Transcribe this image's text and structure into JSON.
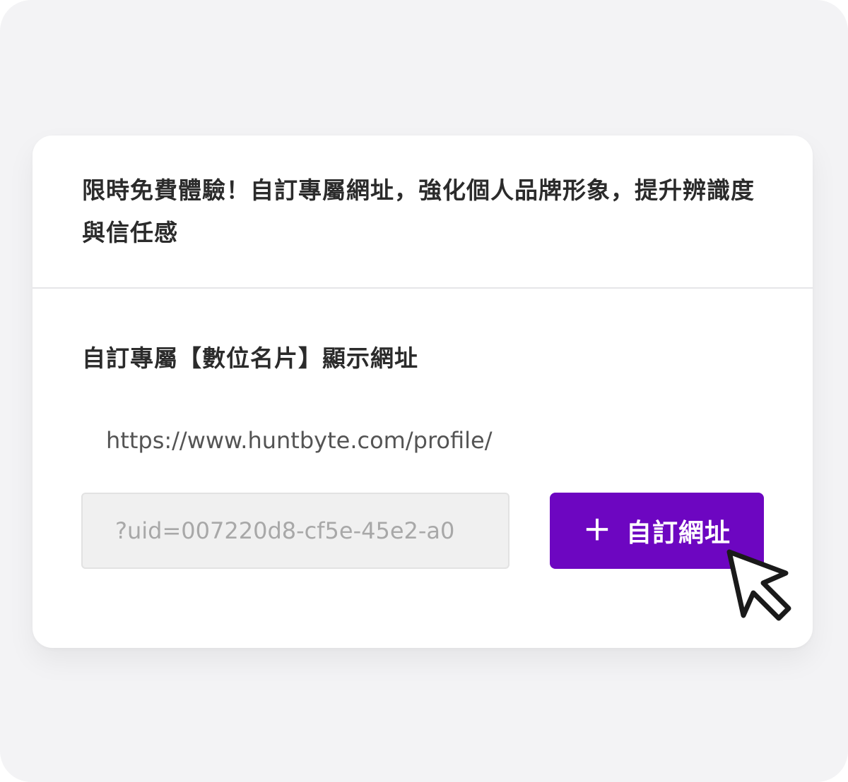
{
  "promo": {
    "text": "限時免費體驗！自訂專屬網址，強化個人品牌形象，提升辨識度與信任感"
  },
  "custom_url": {
    "title": "自訂專屬【數位名片】顯示網址",
    "base_url": "https://www.huntbyte.com/profile/",
    "uid_value": "?uid=007220d8-cf5e-45e2-a0",
    "button_label": "自訂網址",
    "button_icon": "plus-icon"
  },
  "colors": {
    "accent": "#6d06c1",
    "frame_bg": "#f3f3f5",
    "card_bg": "#ffffff",
    "text": "#2b2b2b",
    "input_bg": "#f0f0f0"
  },
  "icons": {
    "cursor": "pointer-cursor-icon"
  }
}
